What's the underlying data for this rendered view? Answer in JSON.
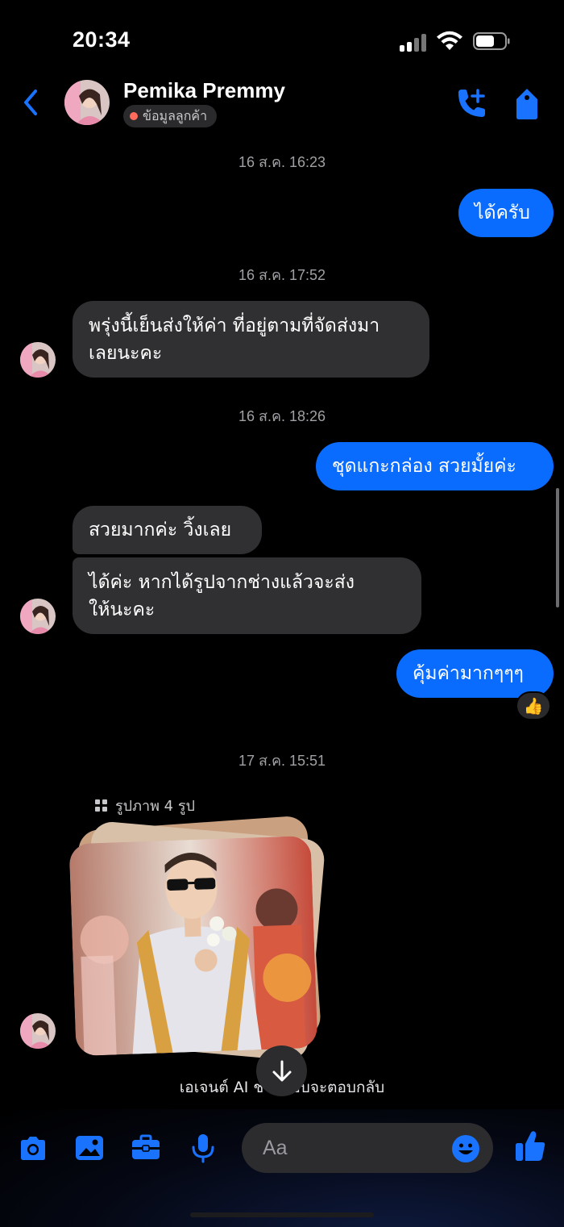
{
  "status_bar": {
    "time": "20:34"
  },
  "header": {
    "contact_name": "Pemika Premmy",
    "customer_info_label": "ข้อมูลลูกค้า"
  },
  "messages": {
    "ts1": "16 ส.ค. 16:23",
    "m1": "ได้ครับ",
    "ts2": "16 ส.ค. 17:52",
    "m2_line1": "พรุ่งนี้เย็นส่งให้ค่า ที่อยู่ตามที่จัดส่งมา",
    "m2_line2": "เลยนะคะ",
    "ts3": "16 ส.ค. 18:26",
    "m3": "ชุดแกะกล่อง สวยมั้ยค่ะ",
    "m4": "สวยมากค่ะ วิ้งเลย",
    "m5_line1": "ได้ค่ะ หากได้รูปจากช่างแล้วจะส่ง",
    "m5_line2": "ให้นะคะ",
    "m6": "คุ้มค่ามากๆๆๆ",
    "reaction": "👍",
    "ts4": "17 ส.ค. 15:51",
    "photos_label": "รูปภาพ 4 รูป"
  },
  "ai_note": "เอเจนต์ AI ช่วยตอบจะตอบกลับ",
  "composer": {
    "placeholder": "Aa"
  },
  "colors": {
    "accent": "#0a6cff",
    "incoming_bubble": "#303032",
    "background": "#000000",
    "status_dot": "#ff6b5c"
  },
  "icons": [
    "back-chevron-icon",
    "call-add-icon",
    "tag-icon",
    "camera-icon",
    "gallery-icon",
    "briefcase-icon",
    "microphone-icon",
    "emoji-icon",
    "thumbs-up-icon",
    "grid-icon",
    "arrow-down-icon"
  ]
}
